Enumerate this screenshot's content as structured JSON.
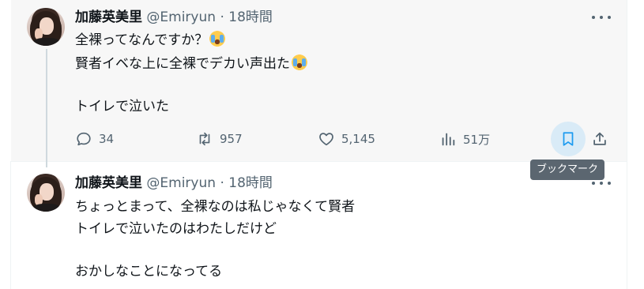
{
  "tweets": [
    {
      "author_name": "加藤英美里",
      "handle": "@Emiryun",
      "dot": "·",
      "time": "18時間",
      "lines": [
        "全裸ってなんですか？",
        "賢者イベな上に全裸でデカい声出た",
        "",
        "トイレで泣いた"
      ],
      "emoji_name": "loudly-crying-face",
      "actions": {
        "replies": "34",
        "retweets": "957",
        "likes": "5,145",
        "views": "51万"
      }
    },
    {
      "author_name": "加藤英美里",
      "handle": "@Emiryun",
      "dot": "·",
      "time": "18時間",
      "lines": [
        "ちょっとまって、全裸なのは私じゃなくて賢者",
        "トイレで泣いたのはわたしだけど",
        "",
        "おかしなことになってる"
      ]
    }
  ],
  "tooltip": "ブックマーク",
  "icons": {
    "reply": "reply-icon",
    "retweet": "retweet-icon",
    "like": "heart-icon",
    "views": "views-icon",
    "bookmark": "bookmark-icon",
    "share": "share-icon",
    "more": "more-icon"
  },
  "colors": {
    "text": "#0f1419",
    "secondary": "#536471",
    "accent": "#1d9bf0",
    "hover_bg": "#f7f7f7",
    "tooltip_bg": "#5b6670"
  }
}
